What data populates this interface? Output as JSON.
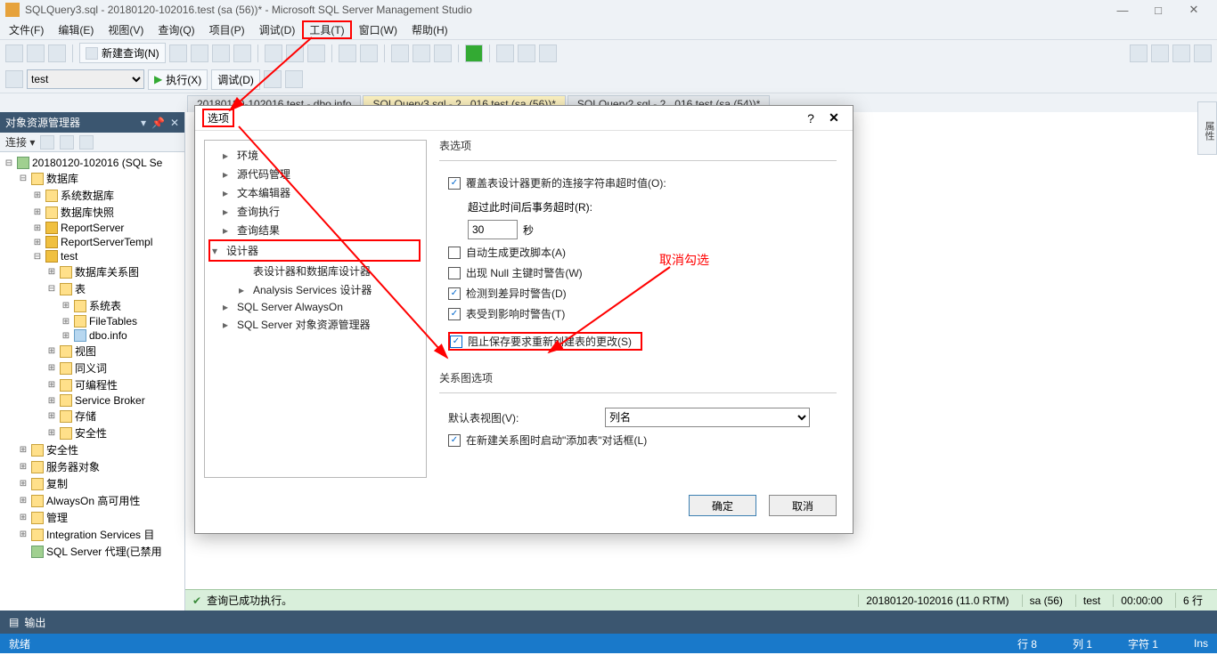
{
  "window": {
    "title": "SQLQuery3.sql - 20180120-102016.test (sa (56))* - Microsoft SQL Server Management Studio",
    "min": "—",
    "max": "□",
    "close": "✕"
  },
  "menu": {
    "items": [
      "文件(F)",
      "编辑(E)",
      "视图(V)",
      "查询(Q)",
      "项目(P)",
      "调试(D)",
      "工具(T)",
      "窗口(W)",
      "帮助(H)"
    ],
    "highlight_index": 6
  },
  "toolbar": {
    "new_query": "新建查询(N)",
    "execute": "执行(X)",
    "debug": "调试(D)",
    "db_selector": "test"
  },
  "tabs": {
    "items": [
      "20180120-102016.test - dbo.info",
      "SQLQuery3.sql - 2...016.test (sa (56))*",
      "SQLQuery2.sql - 2...016.test (sa (54))*"
    ],
    "active_index": 1
  },
  "explorer": {
    "title": "对象资源管理器",
    "connect": "连接 ▾",
    "server": "20180120-102016 (SQL Se",
    "nodes": [
      {
        "l": 0,
        "ico": "srv",
        "t": "20180120-102016 (SQL Se",
        "exp": "⊟"
      },
      {
        "l": 1,
        "ico": "fold",
        "t": "数据库",
        "exp": "⊟"
      },
      {
        "l": 2,
        "ico": "fold",
        "t": "系统数据库",
        "exp": "⊞"
      },
      {
        "l": 2,
        "ico": "fold",
        "t": "数据库快照",
        "exp": "⊞"
      },
      {
        "l": 2,
        "ico": "db",
        "t": "ReportServer",
        "exp": "⊞"
      },
      {
        "l": 2,
        "ico": "db",
        "t": "ReportServerTempl",
        "exp": "⊞"
      },
      {
        "l": 2,
        "ico": "db",
        "t": "test",
        "exp": "⊟"
      },
      {
        "l": 3,
        "ico": "fold",
        "t": "数据库关系图",
        "exp": "⊞"
      },
      {
        "l": 3,
        "ico": "fold",
        "t": "表",
        "exp": "⊟"
      },
      {
        "l": 4,
        "ico": "fold",
        "t": "系统表",
        "exp": "⊞"
      },
      {
        "l": 4,
        "ico": "fold",
        "t": "FileTables",
        "exp": "⊞"
      },
      {
        "l": 4,
        "ico": "tbl",
        "t": "dbo.info",
        "exp": "⊞"
      },
      {
        "l": 3,
        "ico": "fold",
        "t": "视图",
        "exp": "⊞"
      },
      {
        "l": 3,
        "ico": "fold",
        "t": "同义词",
        "exp": "⊞"
      },
      {
        "l": 3,
        "ico": "fold",
        "t": "可编程性",
        "exp": "⊞"
      },
      {
        "l": 3,
        "ico": "fold",
        "t": "Service Broker",
        "exp": "⊞"
      },
      {
        "l": 3,
        "ico": "fold",
        "t": "存储",
        "exp": "⊞"
      },
      {
        "l": 3,
        "ico": "fold",
        "t": "安全性",
        "exp": "⊞"
      },
      {
        "l": 1,
        "ico": "fold",
        "t": "安全性",
        "exp": "⊞"
      },
      {
        "l": 1,
        "ico": "fold",
        "t": "服务器对象",
        "exp": "⊞"
      },
      {
        "l": 1,
        "ico": "fold",
        "t": "复制",
        "exp": "⊞"
      },
      {
        "l": 1,
        "ico": "fold",
        "t": "AlwaysOn 高可用性",
        "exp": "⊞"
      },
      {
        "l": 1,
        "ico": "fold",
        "t": "管理",
        "exp": "⊞"
      },
      {
        "l": 1,
        "ico": "fold",
        "t": "Integration Services 目",
        "exp": "⊞"
      },
      {
        "l": 1,
        "ico": "srv",
        "t": "SQL Server 代理(已禁用",
        "exp": ""
      }
    ]
  },
  "dialog": {
    "title": "选项",
    "help": "?",
    "close": "✕",
    "left": {
      "items": [
        {
          "t": "环境",
          "l": 1,
          "ar": "▸"
        },
        {
          "t": "源代码管理",
          "l": 1,
          "ar": "▸"
        },
        {
          "t": "文本编辑器",
          "l": 1,
          "ar": "▸"
        },
        {
          "t": "查询执行",
          "l": 1,
          "ar": "▸"
        },
        {
          "t": "查询结果",
          "l": 1,
          "ar": "▸"
        },
        {
          "t": "设计器",
          "l": 1,
          "ar": "▾",
          "hl": true
        },
        {
          "t": "表设计器和数据库设计器",
          "l": 2,
          "ar": ""
        },
        {
          "t": "Analysis Services 设计器",
          "l": 2,
          "ar": "▸"
        },
        {
          "t": "SQL Server AlwaysOn",
          "l": 1,
          "ar": "▸"
        },
        {
          "t": "SQL Server 对象资源管理器",
          "l": 1,
          "ar": "▸"
        }
      ]
    },
    "right": {
      "grp1_title": "表选项",
      "override_conn": "覆盖表设计器更新的连接字符串超时值(O):",
      "timeout_label": "超过此时间后事务超时(R):",
      "timeout_value": "30",
      "timeout_unit": "秒",
      "auto_script": "自动生成更改脚本(A)",
      "null_warn": "出现 Null 主键时警告(W)",
      "diff_warn": "检测到差异时警告(D)",
      "affect_warn": "表受到影响时警告(T)",
      "prevent_save": "阻止保存要求重新创建表的更改(S)",
      "grp2_title": "关系图选项",
      "default_view": "默认表视图(V):",
      "default_view_value": "列名",
      "launch_add": "在新建关系图时启动\"添加表\"对话框(L)"
    },
    "ok": "确定",
    "cancel": "取消"
  },
  "annot": {
    "cancel_check": "取消勾选"
  },
  "doc_status": {
    "msg": "查询已成功执行。",
    "server": "20180120-102016 (11.0 RTM)",
    "user": "sa (56)",
    "db": "test",
    "time": "00:00:00",
    "rows": "6 行"
  },
  "output": {
    "label": "输出"
  },
  "statusbar": {
    "ready": "就绪",
    "line": "行 8",
    "col": "列 1",
    "ch": "字符 1",
    "ins": "Ins"
  },
  "side_panel": "属性"
}
